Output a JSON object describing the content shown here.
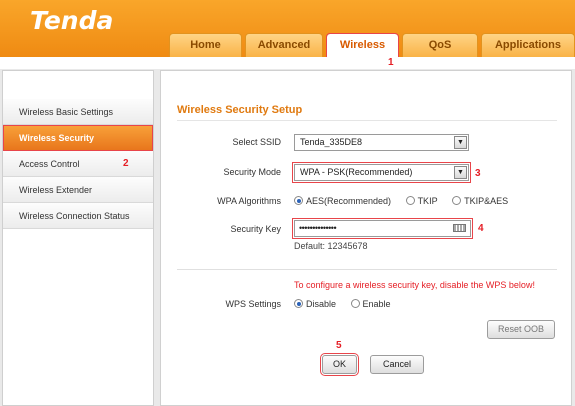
{
  "brand": {
    "logo_text": "Tenda"
  },
  "nav": {
    "tabs": [
      {
        "label": "Home"
      },
      {
        "label": "Advanced"
      },
      {
        "label": "Wireless",
        "active": true
      },
      {
        "label": "QoS"
      },
      {
        "label": "Applications"
      }
    ]
  },
  "markers": {
    "m1": "1",
    "m2": "2",
    "m3": "3",
    "m4": "4",
    "m5": "5"
  },
  "sidebar": {
    "items": [
      {
        "label": "Wireless Basic Settings"
      },
      {
        "label": "Wireless Security",
        "active": true
      },
      {
        "label": "Access Control"
      },
      {
        "label": "Wireless Extender"
      },
      {
        "label": "Wireless Connection Status"
      }
    ]
  },
  "main": {
    "title": "Wireless Security Setup",
    "ssid": {
      "label": "Select SSID",
      "value": "Tenda_335DE8"
    },
    "mode": {
      "label": "Security Mode",
      "value": "WPA - PSK(Recommended)"
    },
    "algorithms": {
      "label": "WPA Algorithms",
      "options": [
        {
          "label": "AES(Recommended)",
          "selected": true
        },
        {
          "label": "TKIP",
          "selected": false
        },
        {
          "label": "TKIP&AES",
          "selected": false
        }
      ]
    },
    "key": {
      "label": "Security Key",
      "value": "••••••••••••••",
      "default_text": "Default: 12345678"
    },
    "wps_note": "To configure a wireless security key, disable the WPS below!",
    "wps": {
      "label": "WPS Settings",
      "options": [
        {
          "label": "Disable",
          "selected": true
        },
        {
          "label": "Enable",
          "selected": false
        }
      ]
    },
    "buttons": {
      "reset": "Reset OOB",
      "ok": "OK",
      "cancel": "Cancel"
    }
  },
  "colors": {
    "accent": "#ef8a12",
    "highlight": "#e8454a",
    "title": "#e07a10",
    "warning": "#e51e25"
  }
}
